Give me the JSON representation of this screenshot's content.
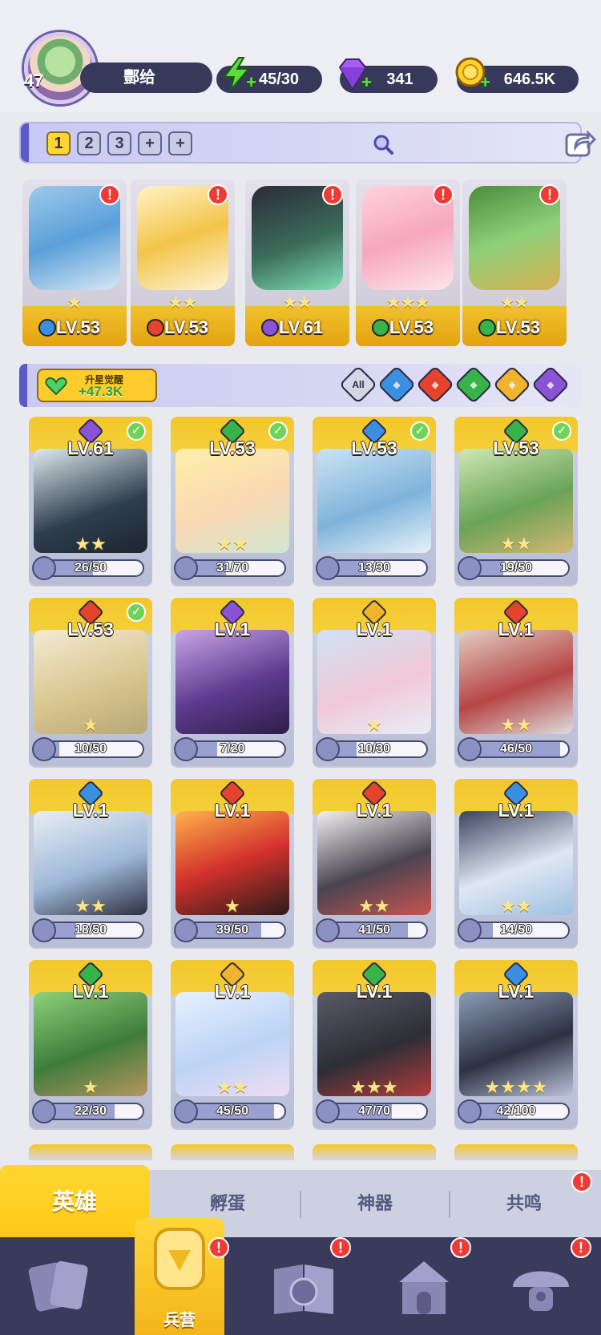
{
  "player": {
    "level": "47",
    "name": "酆给"
  },
  "resources": [
    {
      "name": "energy",
      "icon": "lightning-icon",
      "value": "45/30"
    },
    {
      "name": "gems",
      "icon": "diamond-icon",
      "value": "341"
    },
    {
      "name": "coins",
      "icon": "coin-icon",
      "value": "646.5K"
    }
  ],
  "team_tabs": [
    "1",
    "2",
    "3",
    "+",
    "+"
  ],
  "team_selected": "1",
  "formation": [
    {
      "level": "LV.53",
      "element": "water",
      "stars": 1
    },
    {
      "level": "LV.53",
      "element": "fire",
      "stars": 2
    },
    {
      "level": "LV.61",
      "element": "dark",
      "stars": 2
    },
    {
      "level": "LV.53",
      "element": "nature",
      "stars": 3
    },
    {
      "level": "LV.53",
      "element": "nature",
      "stars": 2
    }
  ],
  "awaken": {
    "label": "升星觉醒",
    "value": "+47.3K"
  },
  "filters": [
    "All",
    "water",
    "fire",
    "nature",
    "light",
    "dark"
  ],
  "heroes": [
    {
      "level": "LV.61",
      "element": "dark",
      "checked": true,
      "stars": 2,
      "shards": "26/50",
      "progress": 0.52
    },
    {
      "level": "LV.53",
      "element": "nature",
      "checked": true,
      "stars": 2,
      "shards": "31/70",
      "progress": 0.44
    },
    {
      "level": "LV.53",
      "element": "water",
      "checked": true,
      "stars": 0,
      "shards": "13/30",
      "progress": 0.43
    },
    {
      "level": "LV.53",
      "element": "nature",
      "checked": true,
      "stars": 2,
      "shards": "19/50",
      "progress": 0.38
    },
    {
      "level": "LV.53",
      "element": "fire",
      "checked": true,
      "stars": 1,
      "shards": "10/50",
      "progress": 0.2
    },
    {
      "level": "LV.1",
      "element": "dark",
      "checked": false,
      "stars": 0,
      "shards": "7/20",
      "progress": 0.35
    },
    {
      "level": "LV.1",
      "element": "light",
      "checked": false,
      "stars": 1,
      "shards": "10/30",
      "progress": 0.33
    },
    {
      "level": "LV.1",
      "element": "fire",
      "checked": false,
      "stars": 2,
      "shards": "46/50",
      "progress": 0.92
    },
    {
      "level": "LV.1",
      "element": "water",
      "checked": false,
      "stars": 2,
      "shards": "18/50",
      "progress": 0.36
    },
    {
      "level": "LV.1",
      "element": "fire",
      "checked": false,
      "stars": 1,
      "shards": "39/50",
      "progress": 0.78
    },
    {
      "level": "LV.1",
      "element": "fire",
      "checked": false,
      "stars": 2,
      "shards": "41/50",
      "progress": 0.82
    },
    {
      "level": "LV.1",
      "element": "water",
      "checked": false,
      "stars": 2,
      "shards": "14/50",
      "progress": 0.28
    },
    {
      "level": "LV.1",
      "element": "nature",
      "checked": false,
      "stars": 1,
      "shards": "22/30",
      "progress": 0.73
    },
    {
      "level": "LV.1",
      "element": "light",
      "checked": false,
      "stars": 2,
      "shards": "45/50",
      "progress": 0.9
    },
    {
      "level": "LV.1",
      "element": "nature",
      "checked": false,
      "stars": 3,
      "shards": "47/70",
      "progress": 0.67
    },
    {
      "level": "LV.1",
      "element": "water",
      "checked": false,
      "stars": 4,
      "shards": "42/100",
      "progress": 0.42
    }
  ],
  "subtabs": [
    "英雄",
    "孵蛋",
    "神器",
    "共鸣"
  ],
  "bottom_nav": [
    {
      "name": "cards",
      "label": ""
    },
    {
      "name": "barracks",
      "label": "兵营"
    },
    {
      "name": "book",
      "label": ""
    },
    {
      "name": "shrine",
      "label": ""
    },
    {
      "name": "mushroom",
      "label": ""
    }
  ],
  "colors": {
    "water": "#3b8fe0",
    "fire": "#e5432c",
    "nature": "#37b34a",
    "light": "#f0b52d",
    "dark": "#8a53d6",
    "gold": "#f3c72b",
    "navy": "#37395a",
    "badge": "#ef3a36"
  }
}
